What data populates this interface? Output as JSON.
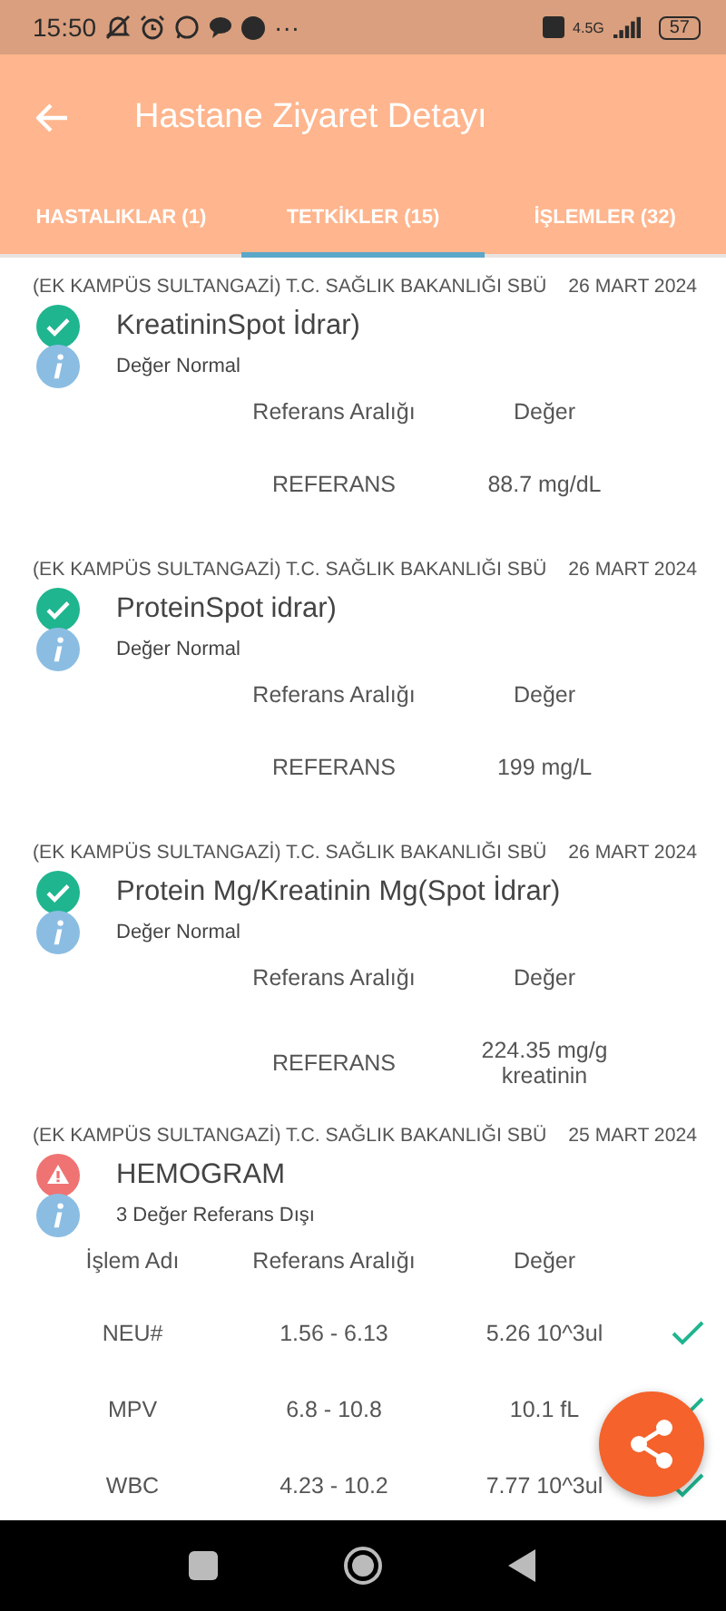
{
  "status_bar": {
    "time": "15:50",
    "more": "···",
    "network": "4.5G",
    "battery": "57"
  },
  "header": {
    "title": "Hastane Ziyaret Detayı"
  },
  "tabs": [
    {
      "label": "HASTALIKLAR (1)",
      "selected": false
    },
    {
      "label": "TETKİKLER (15)",
      "selected": true
    },
    {
      "label": "İŞLEMLER (32)",
      "selected": false
    }
  ],
  "results": [
    {
      "facility": "(EK KAMPÜS SULTANGAZİ) T.C. SAĞLIK BAKANLIĞI SBÜ",
      "date": "26 MART 2024",
      "kind": "normal",
      "title": "KreatininSpot İdrar)",
      "note": "Değer Normal",
      "columns": [
        "Referans Aralığı",
        "Değer"
      ],
      "rows": [
        {
          "cells": [
            "REFERANS",
            "88.7 mg/dL"
          ],
          "checked": false
        }
      ]
    },
    {
      "facility": "(EK KAMPÜS SULTANGAZİ) T.C. SAĞLIK BAKANLIĞI SBÜ",
      "date": "26 MART 2024",
      "kind": "normal",
      "title": "ProteinSpot idrar)",
      "note": "Değer Normal",
      "columns": [
        "Referans Aralığı",
        "Değer"
      ],
      "rows": [
        {
          "cells": [
            "REFERANS",
            "199 mg/L"
          ],
          "checked": false
        }
      ]
    },
    {
      "facility": "(EK KAMPÜS SULTANGAZİ) T.C. SAĞLIK BAKANLIĞI SBÜ",
      "date": "26 MART 2024",
      "kind": "normal",
      "title": "Protein Mg/Kreatinin Mg(Spot İdrar)",
      "note": "Değer Normal",
      "columns": [
        "Referans Aralığı",
        "Değer"
      ],
      "rows": [
        {
          "cells": [
            "REFERANS",
            "224.35 mg/g kreatinin"
          ],
          "checked": false
        }
      ]
    },
    {
      "facility": "(EK KAMPÜS SULTANGAZİ) T.C. SAĞLIK BAKANLIĞI SBÜ",
      "date": "25 MART 2024",
      "kind": "alert",
      "title": "HEMOGRAM",
      "note": "3 Değer Referans Dışı",
      "columns": [
        "İşlem Adı",
        "Referans Aralığı",
        "Değer"
      ],
      "rows": [
        {
          "cells": [
            "NEU#",
            "1.56 - 6.13",
            "5.26 10^3ul"
          ],
          "checked": true
        },
        {
          "cells": [
            "MPV",
            "6.8 - 10.8",
            "10.1 fL"
          ],
          "checked": true
        },
        {
          "cells": [
            "WBC",
            "4.23 - 10.2",
            "7.77 10^3ul"
          ],
          "checked": true
        }
      ]
    }
  ]
}
